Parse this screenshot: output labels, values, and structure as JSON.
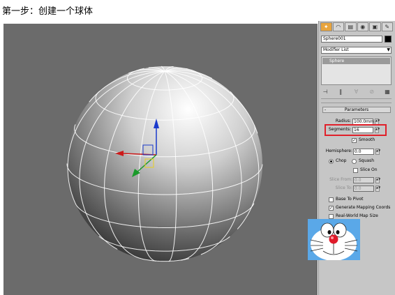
{
  "caption": "第一步：创建一个球体",
  "colors": {
    "viewport_bg": "#6b6b6b",
    "panel_bg": "#c6c6c6",
    "highlight": "#e0202a",
    "axis_x": "#cc1a1a",
    "axis_y": "#1a9a2a",
    "axis_z": "#1a3acc"
  },
  "command_panel": {
    "tabs": [
      {
        "icon": "create-icon"
      },
      {
        "icon": "modify-icon"
      },
      {
        "icon": "hierarchy-icon"
      },
      {
        "icon": "motion-icon"
      },
      {
        "icon": "display-icon"
      },
      {
        "icon": "utilities-icon"
      }
    ],
    "object_name": "Sphere001",
    "modifier_list": "Modifier List",
    "stack_item": "Sphere",
    "stack_tools": [
      {
        "icon": "pin-stack-icon"
      },
      {
        "icon": "show-end-result-icon"
      },
      {
        "icon": "make-unique-icon"
      },
      {
        "icon": "remove-modifier-icon"
      },
      {
        "icon": "configure-sets-icon"
      }
    ]
  },
  "parameters": {
    "title": "Parameters",
    "radius_label": "Radius:",
    "radius_value": "100.0mm",
    "segments_label": "Segments:",
    "segments_value": "16",
    "smooth_label": "Smooth",
    "smooth_checked": true,
    "hemisphere_label": "Hemisphere:",
    "hemisphere_value": "0.0",
    "chop_label": "Chop",
    "squash_label": "Squash",
    "slice_on_label": "Slice On",
    "slice_from_label": "Slice From:",
    "slice_from_value": "0.0",
    "slice_to_label": "Slice To:",
    "slice_to_value": "0.0",
    "base_to_pivot_label": "Base To Pivot",
    "generate_mapping_label": "Generate Mapping Coords",
    "real_world_label": "Real-World Map Size"
  },
  "avatar": {
    "icon": "doraemon-avatar-icon"
  }
}
